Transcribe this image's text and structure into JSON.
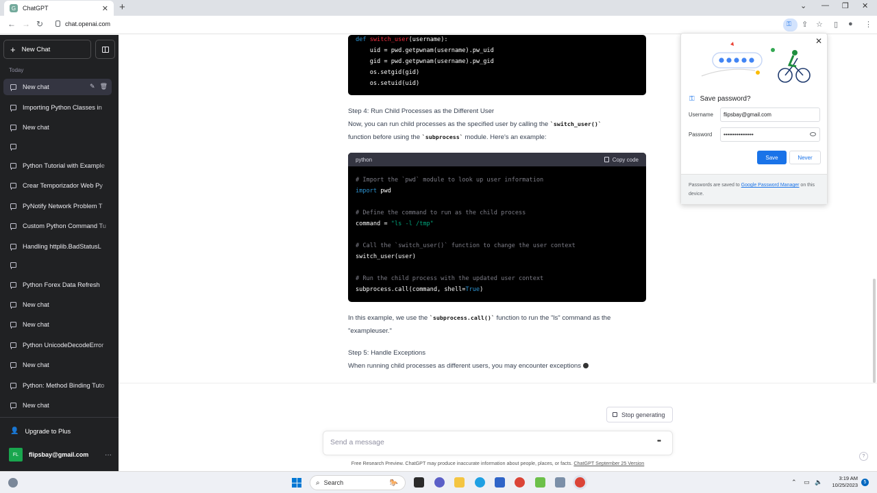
{
  "browser": {
    "tab_title": "ChatGPT",
    "tab_favicon": "G",
    "url": "chat.openai.com",
    "tab_close": "✕",
    "new_tab": "+"
  },
  "sidebar": {
    "new_chat_label": "New Chat",
    "section_label": "Today",
    "items": [
      {
        "label": "New chat"
      },
      {
        "label": "Importing Python Classes in"
      },
      {
        "label": "New chat"
      },
      {
        "label": ""
      },
      {
        "label": "Python Tutorial with Example"
      },
      {
        "label": "Crear Temporizador Web Py"
      },
      {
        "label": "PyNotify Network Problem T"
      },
      {
        "label": "Custom Python Command Tu"
      },
      {
        "label": "Handling httplib.BadStatusL"
      },
      {
        "label": ""
      },
      {
        "label": "Python Forex Data Refresh"
      },
      {
        "label": "New chat"
      },
      {
        "label": "New chat"
      },
      {
        "label": "Python UnicodeDecodeError"
      },
      {
        "label": "New chat"
      },
      {
        "label": "Python: Method Binding Tuto"
      },
      {
        "label": "New chat"
      }
    ],
    "upgrade_label": "Upgrade to Plus",
    "user_initials": "FL",
    "user_email": "flipsbay@gmail.com",
    "more": "···"
  },
  "conversation": {
    "code1": {
      "lines": [
        {
          "kw": "def ",
          "fn": "switch_user",
          "rest": "(username):"
        },
        {
          "text": "    uid = pwd.getpwnam(username).pw_uid"
        },
        {
          "text": "    gid = pwd.getpwnam(username).pw_gid"
        },
        {
          "text": "    os.setgid(gid)"
        },
        {
          "text": "    os.setuid(uid)"
        }
      ]
    },
    "step4_heading": "Step 4: Run Child Processes as the Different User",
    "step4_p1_a": "Now, you can run child processes as the specified user by calling the ",
    "step4_p1_code": "`switch_user()`",
    "step4_p2_a": "function before using the ",
    "step4_p2_code": "`subprocess`",
    "step4_p2_b": " module. Here's an example:",
    "code2": {
      "language": "python",
      "copy_label": "Copy code",
      "comment1": "# Import the `pwd` module to look up user information",
      "import_kw": "import",
      "import_rest": " pwd",
      "comment2": "# Define the command to run as the child process",
      "cmd_a": "command = ",
      "cmd_str": "\"ls -l /tmp\"",
      "comment3": "# Call the `switch_user()` function to change the user context",
      "call_switch": "switch_user(user)",
      "comment4": "# Run the child process with the updated user context",
      "call_a": "subprocess.call(command, shell=",
      "call_bool": "True",
      "call_b": ")"
    },
    "example_a": "In this example, we use the ",
    "example_code": "`subprocess.call()`",
    "example_b": " function to run the \"ls\" command as the",
    "example_line2": "\"exampleuser.\"",
    "step5_heading": "Step 5: Handle Exceptions",
    "step5_text": "When running child processes as different users, you may encounter exceptions"
  },
  "composer": {
    "stop_label": "Stop generating",
    "placeholder": "Send a message",
    "dots": "••",
    "footnote_a": "Free Research Preview. ChatGPT may produce inaccurate information about people, places, or facts. ",
    "footnote_link": "ChatGPT September 25 Version",
    "help": "?"
  },
  "password_popup": {
    "title": "Save password?",
    "username_label": "Username",
    "username_value": "flipsbay@gmail.com",
    "password_label": "Password",
    "password_value": "••••••••••••••••",
    "save_label": "Save",
    "never_label": "Never",
    "footer_a": "Passwords are saved to ",
    "footer_link": "Google Password Manager",
    "footer_b": " on this device.",
    "close": "✕"
  },
  "taskbar": {
    "search_label": "Search",
    "time": "3:19 AM",
    "date": "10/25/2023",
    "notifications": "5"
  },
  "colors": {
    "sidebar_bg": "#202123",
    "accent_blue": "#1a73e8",
    "code_bg": "#000000",
    "avatar_green": "#19a64e"
  }
}
